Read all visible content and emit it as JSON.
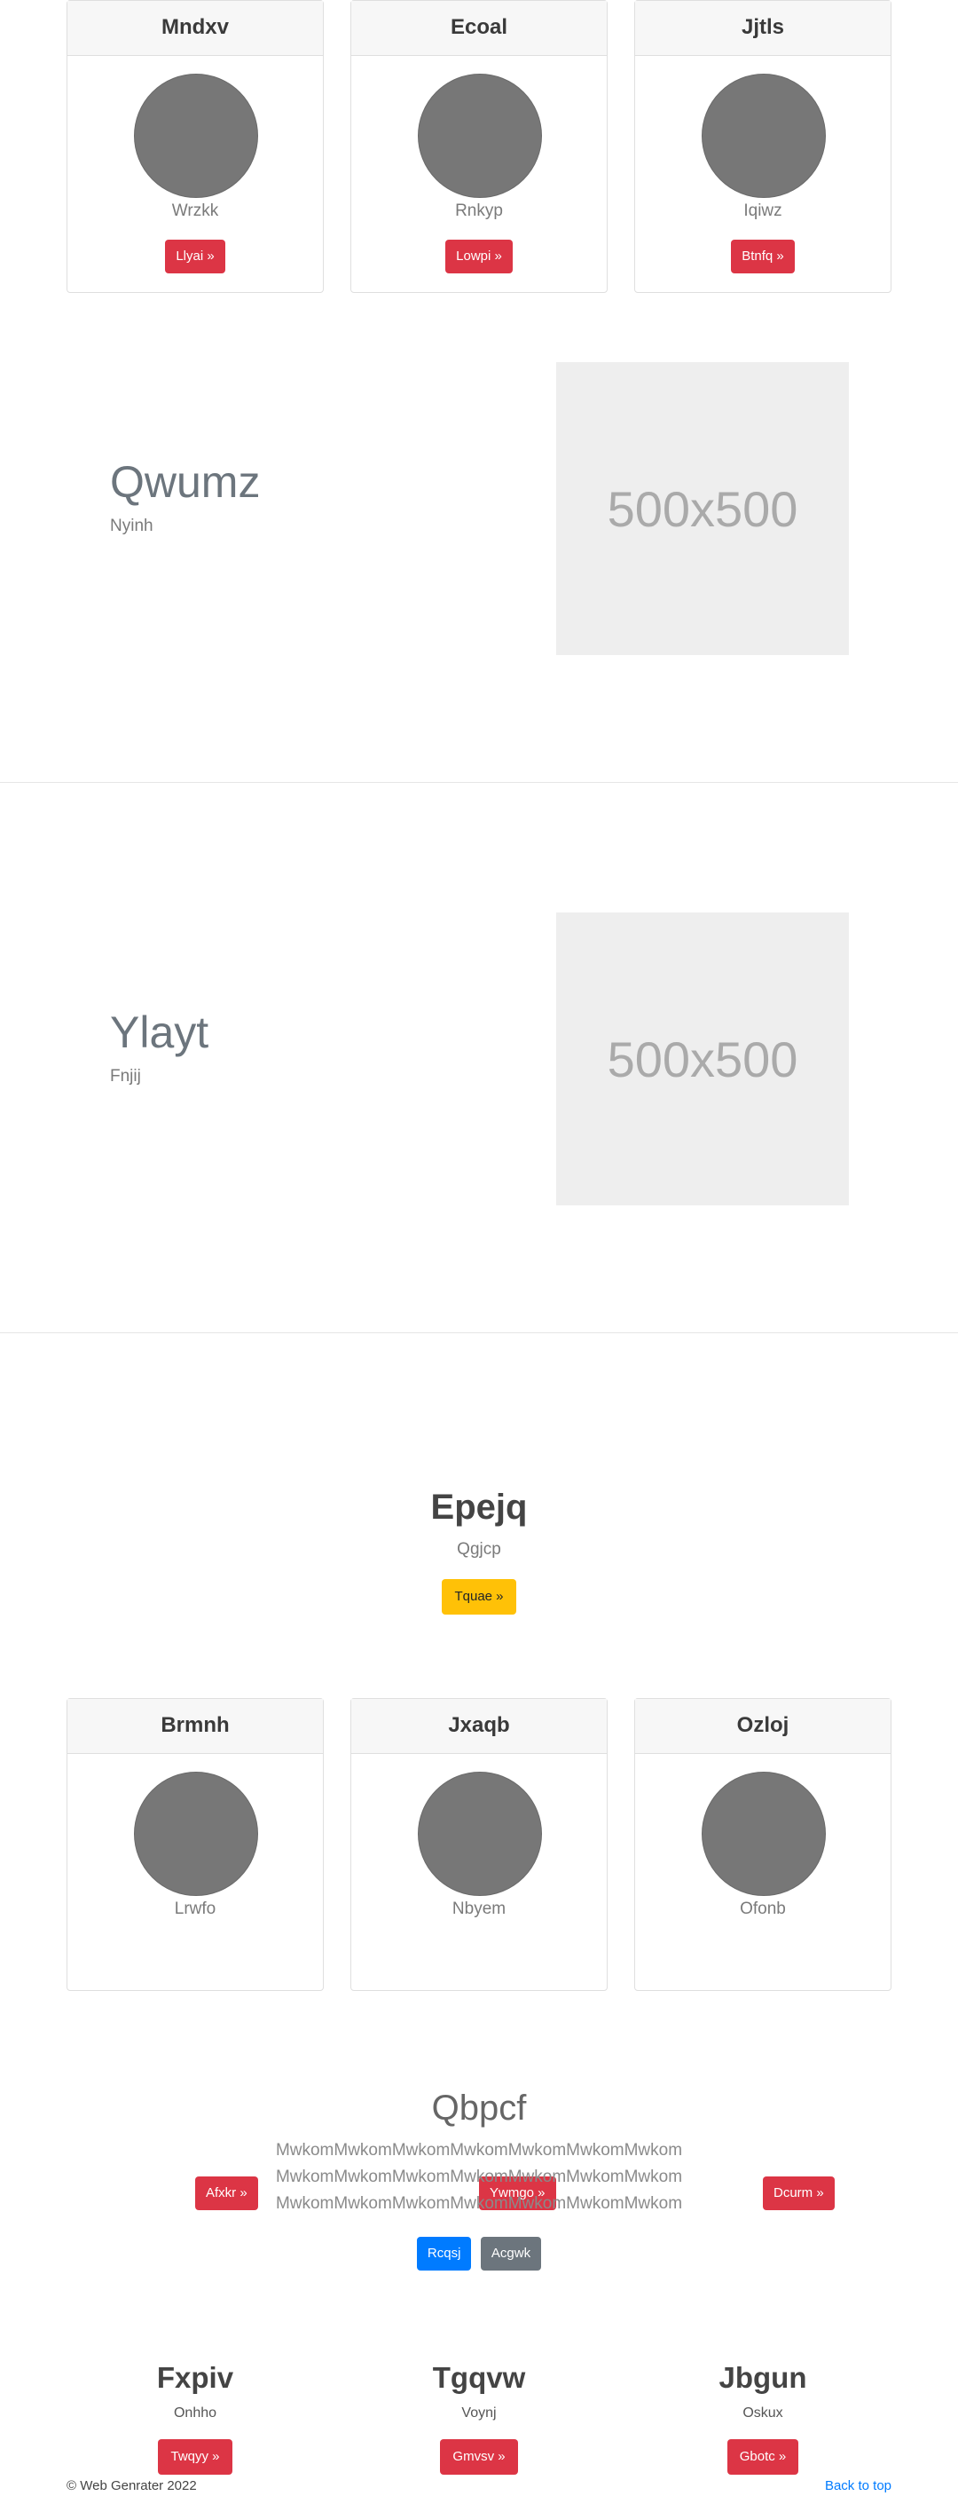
{
  "cards_top": [
    {
      "title": "Mndxv",
      "sub": "Wrzkk",
      "button": "Llyai »"
    },
    {
      "title": "Ecoal",
      "sub": "Rnkyp",
      "button": "Lowpi »"
    },
    {
      "title": "Jjtls",
      "sub": "Iqiwz",
      "button": "Btnfq »"
    }
  ],
  "features": [
    {
      "title": "Qwumz",
      "sub": "Nyinh",
      "image": "500x500"
    },
    {
      "title": "Ylayt",
      "sub": "Fnjij",
      "image": "500x500"
    }
  ],
  "hero": {
    "title": "Epejq",
    "sub": "Qgjcp",
    "button": "Tquae »"
  },
  "cards_bottom": [
    {
      "title": "Brmnh",
      "sub": "Lrwfo",
      "button": "Afxkr »"
    },
    {
      "title": "Jxaqb",
      "sub": "Nbyem",
      "button": "Ywmgo »"
    },
    {
      "title": "Ozloj",
      "sub": "Ofonb",
      "button": "Dcurm »"
    }
  ],
  "jumbo": {
    "title": "Qbpcf",
    "lines": [
      "MwkomMwkomMwkomMwkomMwkomMwkomMwkom",
      "MwkomMwkomMwkomMwkomMwkomMwkomMwkom",
      "MwkomMwkomMwkomMwkomMwkomMwkomMwkom"
    ],
    "primary_button": "Rcqsj",
    "secondary_button": "Acgwk"
  },
  "columns": [
    {
      "title": "Fxpiv",
      "sub": "Onhho",
      "button": "Twqyy »"
    },
    {
      "title": "Tgqvw",
      "sub": "Voynj",
      "button": "Gmvsv »"
    },
    {
      "title": "Jbgun",
      "sub": "Oskux",
      "button": "Gbotc »"
    }
  ],
  "footer": {
    "copyright": "© Web Genrater 2022",
    "back_to_top": "Back to top"
  },
  "colors": {
    "danger": "#dc3545",
    "warning": "#ffc107",
    "primary": "#007bff",
    "secondary": "#6c757d"
  }
}
